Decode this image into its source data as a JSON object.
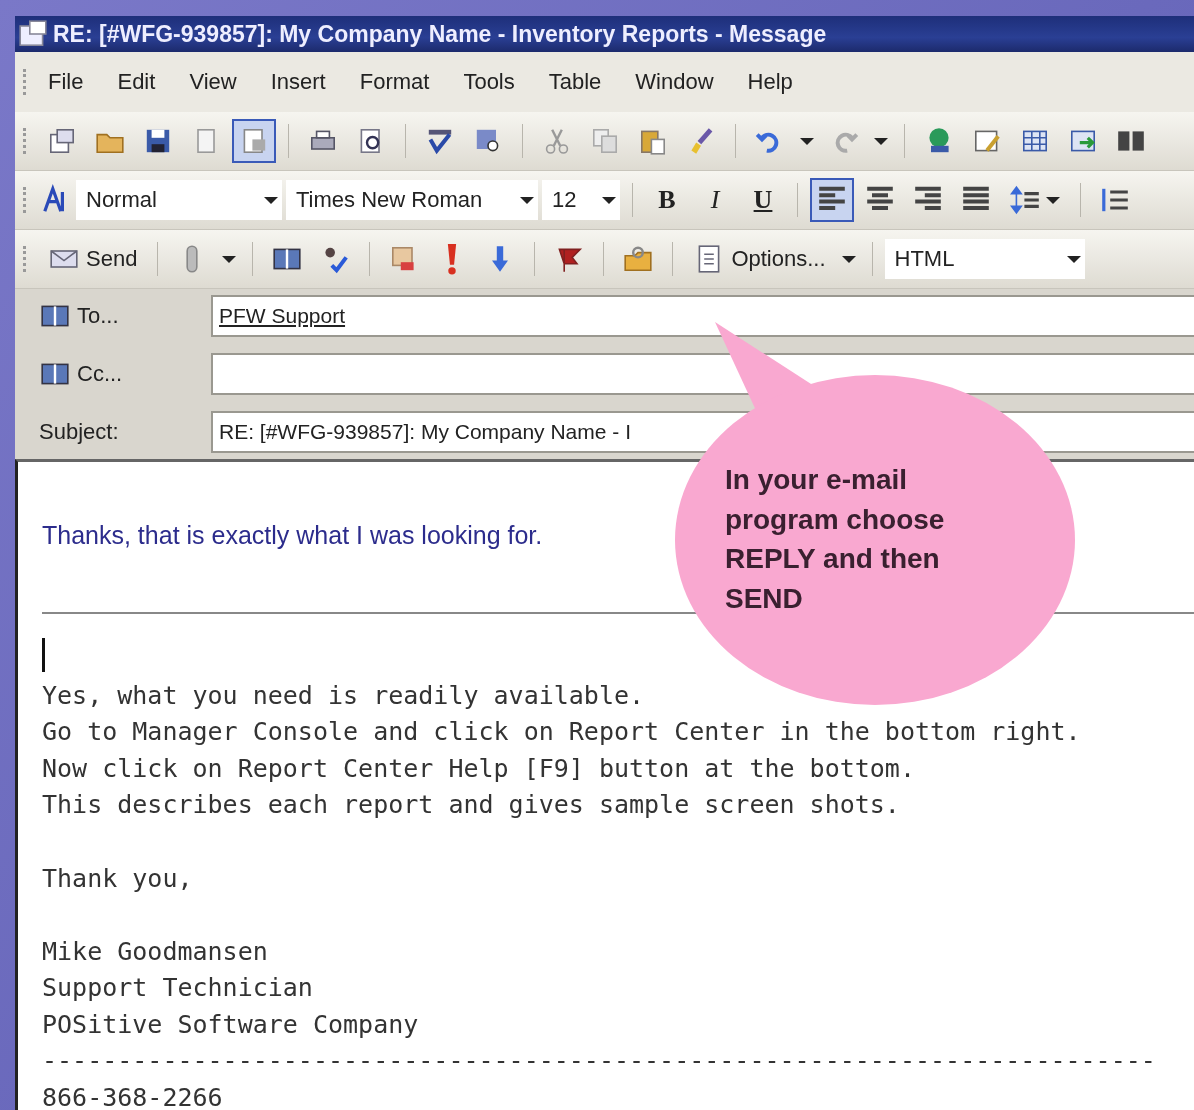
{
  "window": {
    "title": "RE: [#WFG-939857]: My Company Name - Inventory Reports - Message"
  },
  "menu": [
    {
      "label": "File"
    },
    {
      "label": "Edit"
    },
    {
      "label": "View"
    },
    {
      "label": "Insert"
    },
    {
      "label": "Format"
    },
    {
      "label": "Tools"
    },
    {
      "label": "Table"
    },
    {
      "label": "Window"
    },
    {
      "label": "Help"
    }
  ],
  "standard_toolbar": {
    "groups": [
      [
        {
          "kind": "new",
          "selected": false
        },
        {
          "kind": "open",
          "selected": false
        },
        {
          "kind": "save",
          "selected": false
        },
        {
          "kind": "page",
          "selected": false
        },
        {
          "kind": "permission",
          "selected": true
        }
      ],
      [
        {
          "kind": "print",
          "selected": false
        },
        {
          "kind": "preview",
          "selected": false
        }
      ],
      [
        {
          "kind": "spelling",
          "selected": false
        },
        {
          "kind": "research",
          "selected": false
        }
      ],
      [
        {
          "kind": "cut",
          "selected": false
        },
        {
          "kind": "copy",
          "selected": false
        },
        {
          "kind": "paste",
          "selected": false
        },
        {
          "kind": "painter",
          "selected": false
        }
      ],
      [
        {
          "kind": "undo",
          "selected": false
        },
        {
          "kind": "dropdown",
          "selected": false
        },
        {
          "kind": "redo",
          "selected": false
        },
        {
          "kind": "dropdown",
          "selected": false
        }
      ],
      [
        {
          "kind": "hyperlink",
          "selected": false
        },
        {
          "kind": "tables",
          "selected": false
        },
        {
          "kind": "table",
          "selected": false
        },
        {
          "kind": "sheet",
          "selected": false
        },
        {
          "kind": "columns",
          "selected": false
        }
      ]
    ]
  },
  "formatting_toolbar": {
    "style": "Normal",
    "font": "Times New Roman",
    "size": "12",
    "text_buttons": [
      {
        "label": "B",
        "kind": "bold",
        "selected": false
      },
      {
        "label": "I",
        "kind": "italic",
        "selected": false
      },
      {
        "label": "U",
        "kind": "underline",
        "selected": false
      }
    ],
    "alignment": [
      {
        "kind": "left",
        "selected": true
      },
      {
        "kind": "center",
        "selected": false
      },
      {
        "kind": "right",
        "selected": false
      },
      {
        "kind": "justify",
        "selected": false
      }
    ]
  },
  "message_toolbar": {
    "send": "Send",
    "options": "Options...",
    "format": "HTML"
  },
  "header": {
    "to_button": "To...",
    "to": "PFW Support",
    "cc_button": "Cc...",
    "subject_label": "Subject:",
    "subject": "RE: [#WFG-939857]: My Company Name - I"
  },
  "body": {
    "quoted": "Thanks, that is exactly what I was looking for.",
    "paragraphs": [
      [
        "Yes, what you need is readily available.",
        "Go to Manager Console and click on Report Center in the bottom right.",
        "Now click on Report Center Help [F9] button at the bottom.",
        "This describes each report and gives sample screen shots."
      ],
      [
        "Thank you,"
      ],
      [
        "Mike Goodmansen",
        "Support Technician",
        "POSitive Software Company",
        "--------------------------------------------------------------------------",
        "866-368-2266"
      ]
    ]
  },
  "callout": {
    "text": "In your e-mail program choose REPLY and then SEND"
  }
}
